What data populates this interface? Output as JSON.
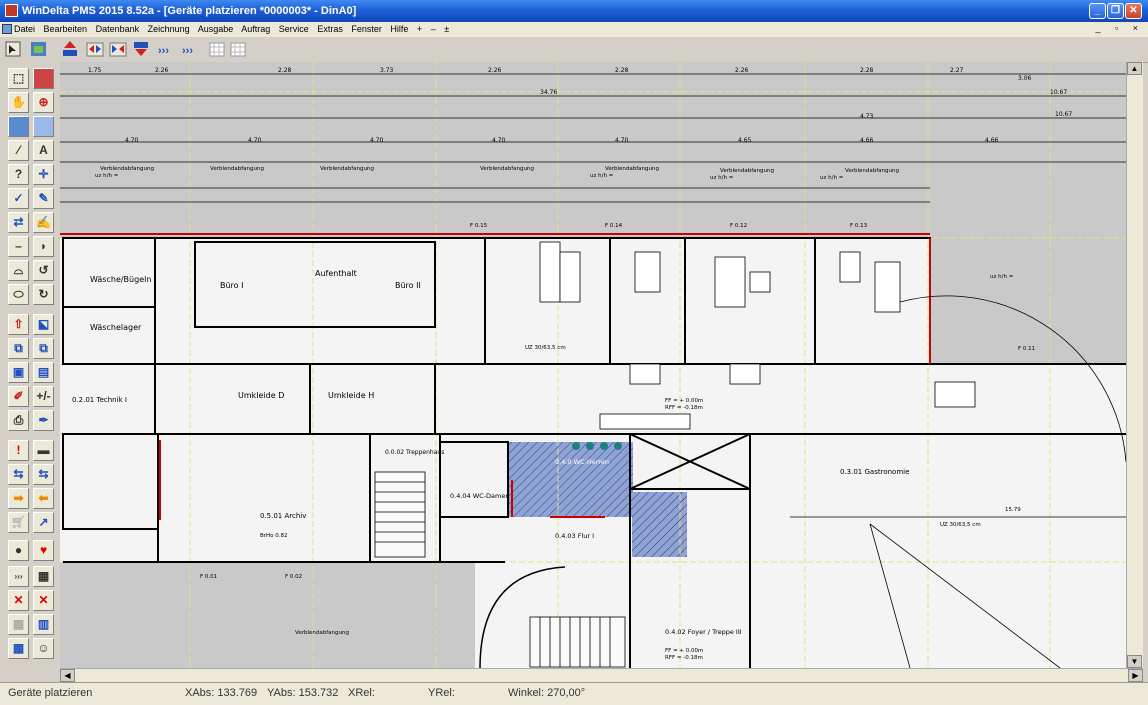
{
  "titlebar": {
    "title": "WinDelta PMS 2015 8.52a - [Geräte platzieren *0000003* - DinA0]",
    "buttons": {
      "minimize": "_",
      "maximize": "❐",
      "close": "✕"
    }
  },
  "menubar": {
    "items": [
      "Datei",
      "Bearbeiten",
      "Datenbank",
      "Zeichnung",
      "Ausgabe",
      "Auftrag",
      "Service",
      "Extras",
      "Fenster",
      "Hilfe",
      "+",
      "–",
      "±"
    ],
    "mdi_controls": "_ ▫ ×"
  },
  "toolbar": {
    "icons": [
      "select-icon",
      "layers-icon",
      "upload-icon",
      "arrows-lr-icon",
      "arrows-rl-icon",
      "download-icon",
      "forward-icon",
      "forward2-icon",
      "grid-icon",
      "grid2-icon"
    ],
    "forward_label": "›››",
    "forward2_label": "›››"
  },
  "palette": {
    "labels": {
      "text": "A",
      "help": "?",
      "exclaim": "!",
      "triple": "›››",
      "minus": "–",
      "plus_minus": "+/-"
    }
  },
  "drawing": {
    "colors": {
      "background": "#c9c9c9",
      "line": "#000000",
      "axis": "#e2e27a",
      "highlight_blue": "#8ea3d6",
      "accent_red": "#cc0000",
      "teal": "#1f8080"
    },
    "rooms": [
      {
        "label": "Wäsche/Bügeln"
      },
      {
        "label": "Wäschelager"
      },
      {
        "label": "Büro I"
      },
      {
        "label": "Aufenthalt"
      },
      {
        "label": "Büro II"
      },
      {
        "label": "Umkleide D"
      },
      {
        "label": "Umkleide H"
      },
      {
        "label": "0.2.01 Technik I"
      },
      {
        "label": "0.5.01 Archiv"
      },
      {
        "label": "0.0.02 Treppenhaus"
      },
      {
        "label": "0.4.04 WC-Damen"
      },
      {
        "label": "0.4.0 WC-Herren"
      },
      {
        "label": "0.4.03 Flur I"
      },
      {
        "label": "0.3.01 Gastronomie"
      },
      {
        "label": "0.4.02 Foyer / Treppe III"
      },
      {
        "label": "Verblendabfangung"
      }
    ],
    "dims": {
      "d1": "1.75",
      "d2": "2.26",
      "d3": "2.28",
      "d4": "3.73",
      "d5": "34.76",
      "d6": "10.67",
      "d7": "4.70",
      "d8": "4.73",
      "d9": "4.65",
      "d10": "4.66",
      "d11": "15.79",
      "d12": "2.27",
      "d13": "3.06",
      "d14": "UZ 30/63,5 cm",
      "d15": "F 0.11",
      "d16": "F 0.01",
      "d17": "F 0.02",
      "d18": "BrHo 0.82",
      "d19": "F 0.13",
      "d20": "F 0.14",
      "d21": "F 0.12",
      "d22": "F 0.15",
      "d23": "FF = + 0.00m",
      "d24": "RFF = -0.18m",
      "d25": "uz h/h ="
    }
  },
  "statusbar": {
    "mode": "Geräte platzieren",
    "xabs": "XAbs: 133.769",
    "yabs": "YAbs: 153.732",
    "xrel": "XRel:",
    "yrel": "YRel:",
    "winkel": "Winkel: 270,00°"
  }
}
